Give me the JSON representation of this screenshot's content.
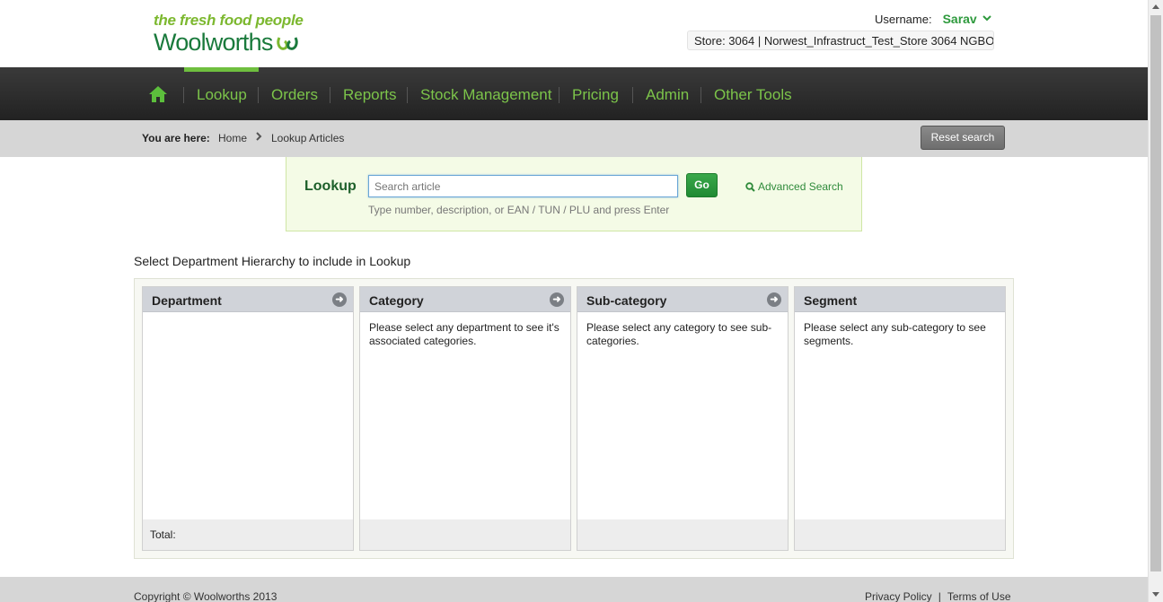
{
  "header": {
    "tagline": "the fresh food people",
    "brand": "Woolworths",
    "username_label": "Username:",
    "username": "Sarav",
    "store": "Store: 3064 | Norwest_Infrastruct_Test_Store 3064 NGBO"
  },
  "nav": {
    "items": [
      "Lookup",
      "Orders",
      "Reports",
      "Stock Management",
      "Pricing",
      "Admin",
      "Other Tools"
    ],
    "active": "Lookup"
  },
  "breadcrumb": {
    "label": "You are here:",
    "home": "Home",
    "current": "Lookup Articles",
    "reset_label": "Reset search"
  },
  "lookup": {
    "label": "Lookup",
    "placeholder": "Search article",
    "go_label": "Go",
    "advanced_label": "Advanced Search",
    "hint": "Type number, description, or EAN / TUN / PLU and press Enter"
  },
  "hierarchy": {
    "title": "Select Department Hierarchy to include in Lookup",
    "columns": [
      {
        "title": "Department",
        "body": "",
        "footer": "Total:"
      },
      {
        "title": "Category",
        "body": "Please select any department to see it's associated categories.",
        "footer": ""
      },
      {
        "title": "Sub-category",
        "body": "Please select any category to see sub-categories.",
        "footer": ""
      },
      {
        "title": "Segment",
        "body": "Please select any sub-category to see segments.",
        "footer": ""
      }
    ]
  },
  "footer": {
    "copyright": "Copyright © Woolworths 2013",
    "privacy": "Privacy Policy",
    "terms": "Terms of Use"
  },
  "colors": {
    "accent_green": "#7cc44a",
    "brand_green": "#1a7a3c",
    "nav_bg": "#2a2a2a"
  }
}
